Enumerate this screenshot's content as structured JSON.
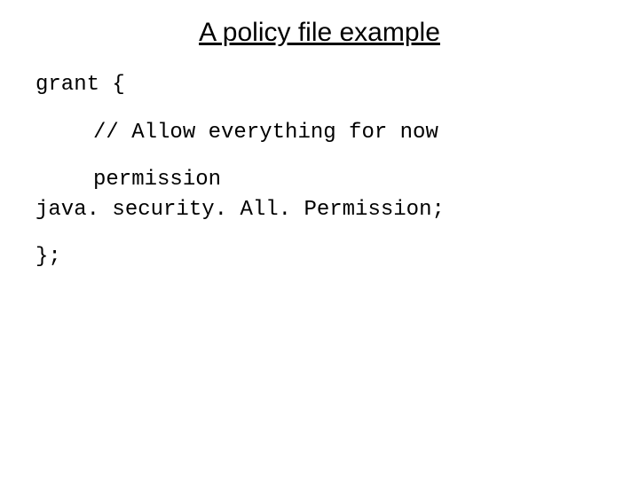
{
  "title": "A policy file example",
  "code": {
    "line1": "grant {",
    "line2": "// Allow everything for now",
    "line3": "permission",
    "line4": "java. security. All. Permission;",
    "line5": "};"
  }
}
